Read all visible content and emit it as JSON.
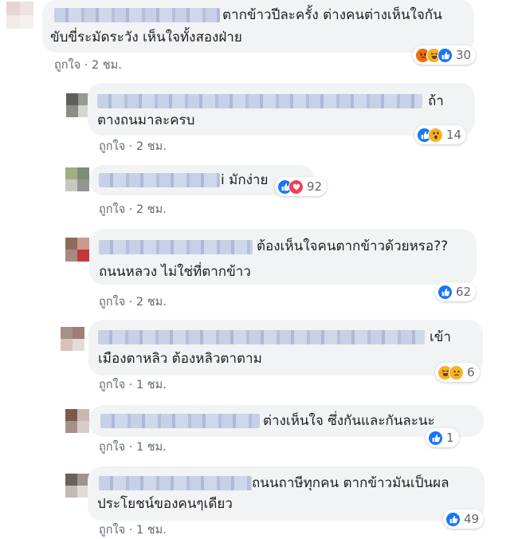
{
  "comments": [
    {
      "line1": "ตากข้าวปีละครั้ง ต่างคนต่างเห็นใจกัน",
      "line2": "ขับขี่ระมัดระวัง เห็นใจทั้งสองฝ่าย",
      "like_label": "ถูกใจ",
      "time": "· 2 ชม.",
      "reactions": [
        "angry-icon",
        "haha-icon",
        "like-icon"
      ],
      "reaction_count": "30"
    },
    {
      "line1": "ถ้า",
      "line2": "ตางถนมาละครบ",
      "like_label": "ถูกใจ",
      "time": "· 2 ชม.",
      "reactions": [
        "like-icon",
        "wow-icon"
      ],
      "reaction_count": "14"
    },
    {
      "line1": "i มักง่าย",
      "like_label": "ถูกใจ",
      "time": "· 2 ชม.",
      "reactions": [
        "like-icon",
        "love-icon"
      ],
      "reaction_count": "92"
    },
    {
      "line1": "ต้องเห็นใจคนตากข้าวด้วยหรอ??",
      "line2": "ถนนหลวง ไม่ใช่ที่ตากข้าว",
      "like_label": "ถูกใจ",
      "time": "· 2 ชม.",
      "reactions": [
        "like-icon"
      ],
      "reaction_count": "62"
    },
    {
      "line1": "เข้า",
      "line2": "เมืองตาหลิว ต้องหลิวตาตาม",
      "like_label": "ถูกใจ",
      "time": "· 1 ชม.",
      "reactions": [
        "haha-icon",
        "sad-icon"
      ],
      "reaction_count": "6"
    },
    {
      "line1": "ต่างเห็นใจ ซึ่งกันและกันละนะ",
      "like_label": "ถูกใจ",
      "time": "· 1 ชม.",
      "reactions": [
        "like-icon"
      ],
      "reaction_count": "1"
    },
    {
      "line1": "ถนนถาษีทุกคน ตากข้าวมันเป็นผล",
      "line2": "ประโยชน์ของคนๆเดียว",
      "like_label": "ถูกใจ",
      "time": "· 1 ชม.",
      "reactions": [
        "like-icon"
      ],
      "reaction_count": "49"
    }
  ],
  "colors": {
    "bubble": "#f2f3f5",
    "like_blue": "#1877f2",
    "meta_gray": "#606770",
    "love_red": "#f33e58",
    "emoji_yellow": "#f7b125"
  }
}
